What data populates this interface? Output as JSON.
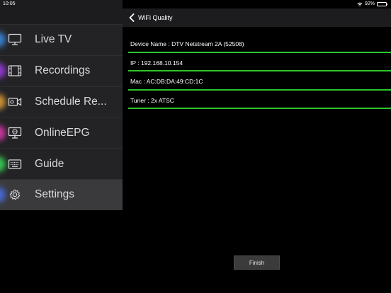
{
  "status_bar": {
    "time": "10:05",
    "battery": "92%",
    "battery_level": 0.92
  },
  "sidebar": {
    "items": [
      {
        "label": "Live TV",
        "icon": "monitor-icon",
        "glow": "#3a8ee8",
        "active": false
      },
      {
        "label": "Recordings",
        "icon": "film-icon",
        "glow": "#a13ae8",
        "active": false
      },
      {
        "label": "Schedule Re...",
        "icon": "camcorder-icon",
        "glow": "#e8a33a",
        "active": false
      },
      {
        "label": "OnlineEPG",
        "icon": "globe-monitor-icon",
        "glow": "#e03ab0",
        "active": false
      },
      {
        "label": "Guide",
        "icon": "keyboard-icon",
        "glow": "#3ae05a",
        "active": false
      },
      {
        "label": "Settings",
        "icon": "gear-icon",
        "glow": "#4a6fe8",
        "active": true
      }
    ]
  },
  "nav": {
    "title": "WiFi Quality"
  },
  "info": {
    "rows": [
      {
        "text": "Device Name : DTV Netstream 2A (52508)"
      },
      {
        "text": "IP : 192.168.10.154"
      },
      {
        "text": "Mac : AC:DB:DA:49:CD:1C"
      },
      {
        "text": "Tuner : 2x ATSC"
      }
    ]
  },
  "actions": {
    "finish_label": "Finish"
  },
  "colors": {
    "accent_line": "#2ec52e",
    "sidebar_bg": "#232325",
    "active_bg": "#3a3a3d"
  }
}
